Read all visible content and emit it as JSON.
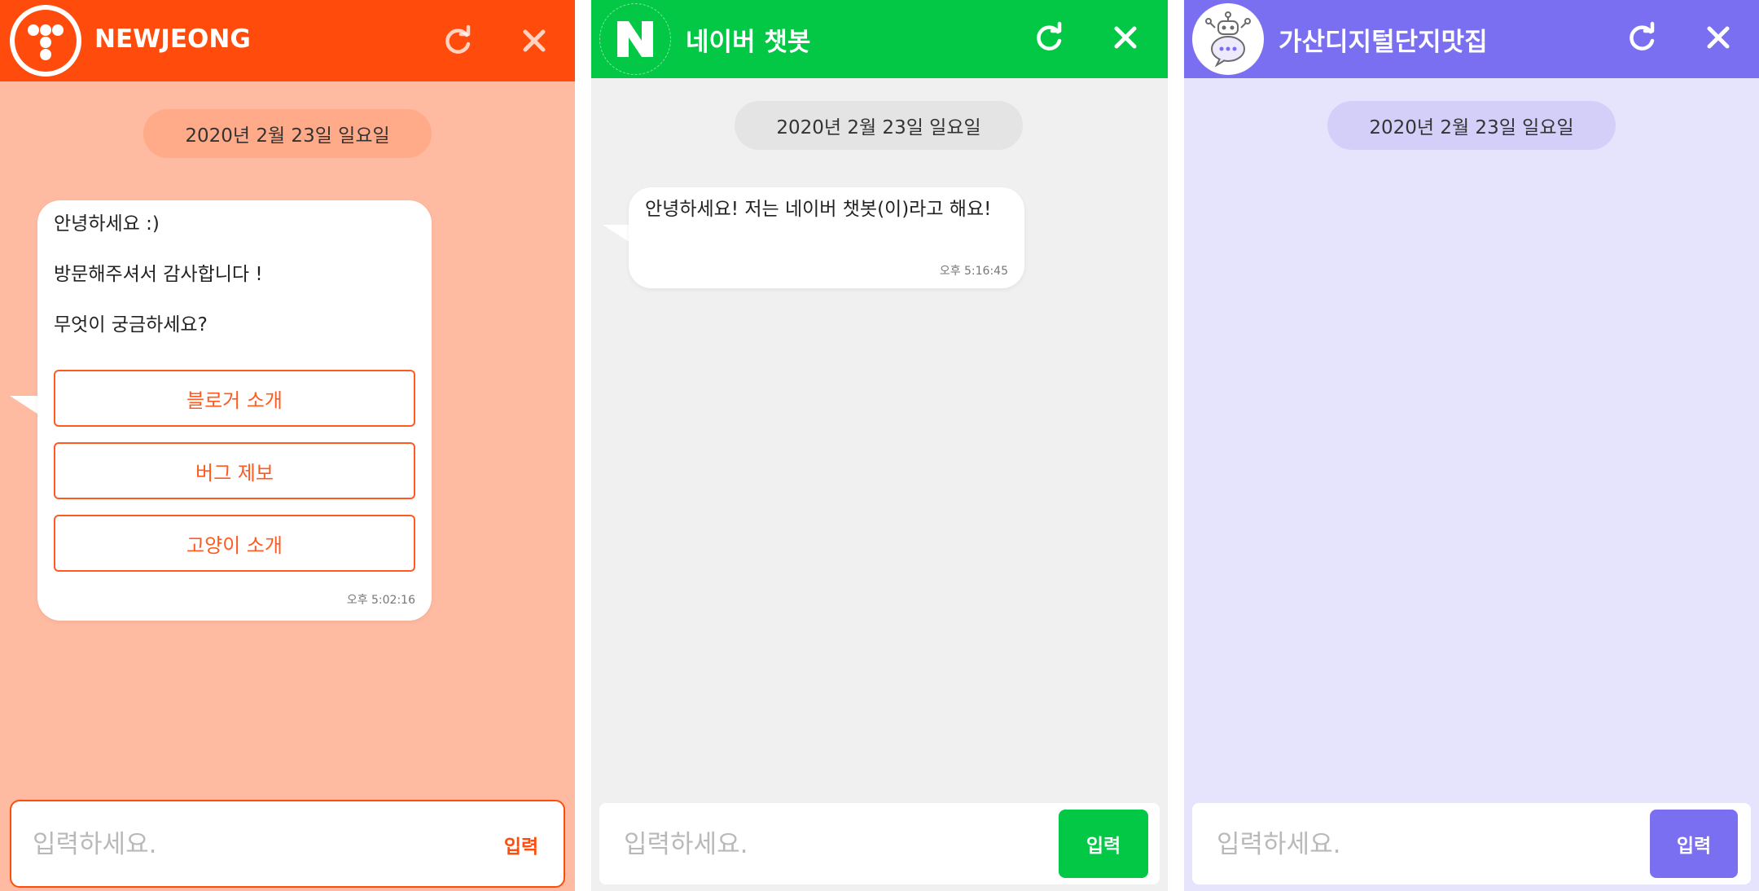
{
  "colors": {
    "orange_accent": "#ff4c0d",
    "orange_bg": "#ffbba1",
    "green_accent": "#03c845",
    "gray_bg": "#f0f0f0",
    "purple_accent": "#7a6ff0",
    "purple_bg": "#e6e4fc"
  },
  "panels": [
    {
      "title": "NEWJEONG",
      "logo_icon": "dots-logo-icon",
      "date": "2020년 2월 23일 일요일",
      "message_lines": [
        "안녕하세요 :)",
        "방문해주셔서 감사합니다 !",
        "무엇이 궁금하세요?"
      ],
      "buttons": [
        "블로거 소개",
        "버그 제보",
        "고양이 소개"
      ],
      "time": "오후 5:02:16",
      "input_placeholder": "입력하세요.",
      "send_label": "입력"
    },
    {
      "title": "네이버 챗봇",
      "logo_icon": "naver-n-logo-icon",
      "date": "2020년 2월 23일 일요일",
      "message": "안녕하세요! 저는 네이버 챗봇(이)라고 해요!",
      "time": "오후 5:16:45",
      "input_placeholder": "입력하세요.",
      "send_label": "입력"
    },
    {
      "title": "가산디지털단지맛집",
      "logo_icon": "robot-logo-icon",
      "date": "2020년 2월 23일 일요일",
      "input_placeholder": "입력하세요.",
      "send_label": "입력"
    }
  ],
  "icons": {
    "refresh": "refresh-icon",
    "close": "close-icon"
  }
}
